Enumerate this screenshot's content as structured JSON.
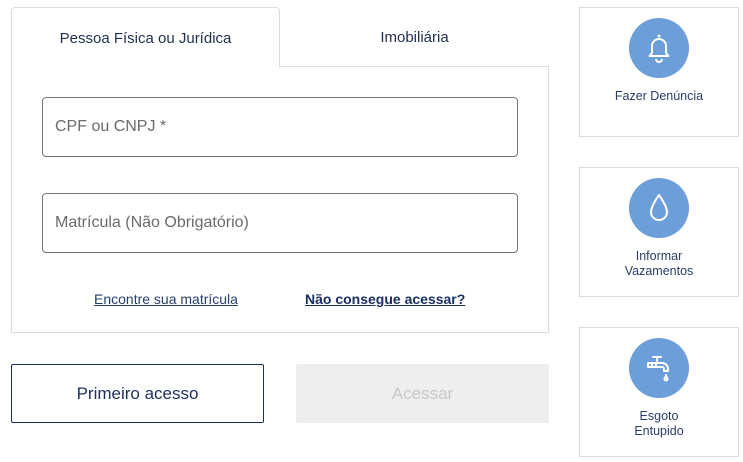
{
  "tabs": [
    {
      "label": "Pessoa Física ou Jurídica",
      "active": true
    },
    {
      "label": "Imobiliária",
      "active": false
    }
  ],
  "form": {
    "cpf_placeholder": "CPF ou CNPJ *",
    "cpf_value": "",
    "matricula_placeholder": "Matrícula (Não Obrigatório)",
    "matricula_value": "",
    "find_link": "Encontre sua matrícula",
    "cant_access_link": "Não consegue acessar?"
  },
  "buttons": {
    "first_access": "Primeiro acesso",
    "access": "Acessar"
  },
  "services": [
    {
      "label_line1": "Fazer Denúncia",
      "label_line2": "",
      "icon": "bell-icon"
    },
    {
      "label_line1": "Informar",
      "label_line2": "Vazamentos",
      "icon": "water-drop-icon"
    },
    {
      "label_line1": "Esgoto",
      "label_line2": "Entupido",
      "icon": "faucet-icon"
    }
  ],
  "colors": {
    "brand_dark": "#1c2f5c",
    "icon_circle": "#6c9fd9",
    "disabled_bg": "#eeeeef"
  }
}
